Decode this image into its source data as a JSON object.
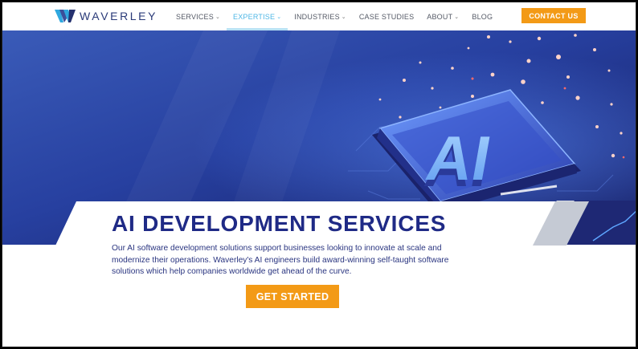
{
  "brand": {
    "name": "WAVERLEY",
    "accent": "#f39a16",
    "primary": "#1f2a86"
  },
  "nav": {
    "items": [
      {
        "label": "SERVICES",
        "has_dropdown": true,
        "active": false
      },
      {
        "label": "EXPERTISE",
        "has_dropdown": true,
        "active": true
      },
      {
        "label": "INDUSTRIES",
        "has_dropdown": true,
        "active": false
      },
      {
        "label": "CASE STUDIES",
        "has_dropdown": false,
        "active": false
      },
      {
        "label": "ABOUT",
        "has_dropdown": true,
        "active": false
      },
      {
        "label": "BLOG",
        "has_dropdown": false,
        "active": false
      }
    ],
    "contact_label": "CONTACT US"
  },
  "hero": {
    "chip_text": "AI",
    "title": "AI DEVELOPMENT SERVICES",
    "description": "Our AI software development solutions support businesses looking to innovate at scale and modernize their operations. Waverley's AI engineers build award-winning self-taught software solutions which help companies worldwide get ahead of the curve.",
    "cta_label": "GET STARTED"
  }
}
